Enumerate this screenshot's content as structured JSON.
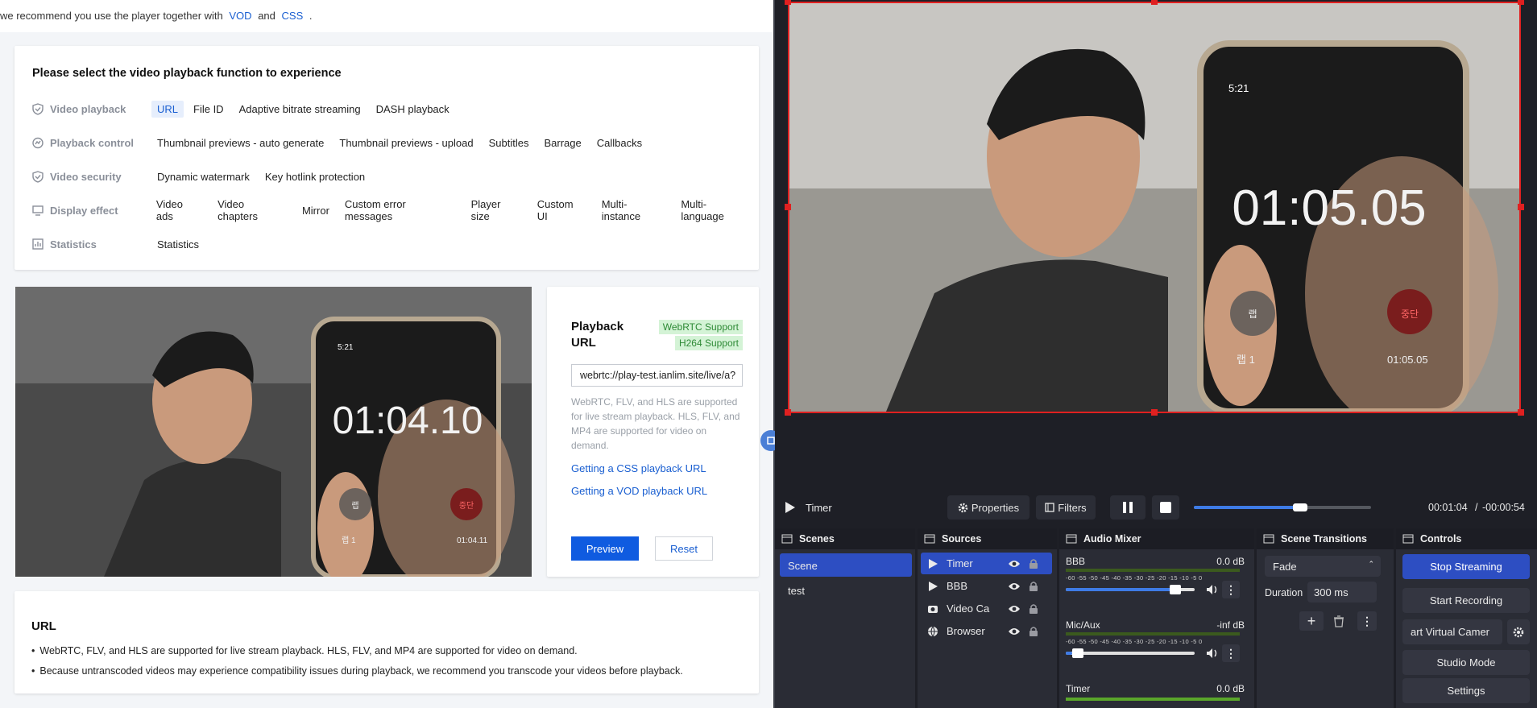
{
  "notice": {
    "pre": "we recommend you use the player together with",
    "link1": "VOD",
    "and": "and",
    "link2": "CSS",
    "post": "."
  },
  "features": {
    "title": "Please select the video playback function to experience",
    "rows": [
      {
        "category": "Video playback",
        "icon": "shield-icon",
        "items": [
          "URL",
          "File ID",
          "Adaptive bitrate streaming",
          "DASH playback"
        ]
      },
      {
        "category": "Playback control",
        "icon": "control-icon",
        "items": [
          "Thumbnail previews - auto generate",
          "Thumbnail previews - upload",
          "Subtitles",
          "Barrage",
          "Callbacks"
        ]
      },
      {
        "category": "Video security",
        "icon": "shield-check-icon",
        "items": [
          "Dynamic watermark",
          "Key hotlink protection"
        ]
      },
      {
        "category": "Display effect",
        "icon": "monitor-icon",
        "items": [
          "Video ads",
          "Video chapters",
          "Mirror",
          "Custom error messages",
          "Player size",
          "Custom UI",
          "Multi-instance",
          "Multi-language"
        ]
      },
      {
        "category": "Statistics",
        "icon": "bar-chart-icon",
        "items": [
          "Statistics"
        ]
      }
    ],
    "active": "URL"
  },
  "video": {
    "timer": "01:04.10",
    "phone_time": "5:21",
    "phone_small": "01:04.11",
    "phone_label": "랩 1",
    "stop_label": "중단",
    "lap_label": "랩"
  },
  "playback": {
    "title": "Playback URL",
    "badges": [
      "WebRTC Support",
      "H264 Support"
    ],
    "url_value": "webrtc://play-test.ianlim.site/live/a?",
    "description": "WebRTC, FLV, and HLS are supported for live stream playback. HLS, FLV, and MP4 are supported for video on demand.",
    "link_css": "Getting a CSS playback URL",
    "link_vod": "Getting a VOD playback URL",
    "preview_label": "Preview",
    "reset_label": "Reset"
  },
  "info": {
    "title": "URL",
    "bullets": [
      "WebRTC, FLV, and HLS are supported for live stream playback. HLS, FLV, and MP4 are supported for video on demand.",
      "Because untranscoded videos may experience compatibility issues during playback, we recommend you transcode your videos before playback."
    ]
  },
  "obs": {
    "preview": {
      "timer": "01:05.05",
      "phone_time": "5:21",
      "phone_small": "01:05.05",
      "phone_label": "랩 1",
      "stop_label": "중단",
      "lap_label": "랩"
    },
    "media": {
      "source": "Timer",
      "properties": "Properties",
      "filters": "Filters",
      "elapsed": "00:01:04",
      "remaining": "-00:00:54",
      "progress": 0.6
    },
    "scenes": {
      "title": "Scenes",
      "items": [
        "Scene",
        "test"
      ],
      "selected": "Scene"
    },
    "sources": {
      "title": "Sources",
      "items": [
        "Timer",
        "BBB",
        "Video Ca",
        "Browser"
      ],
      "selected": "Timer"
    },
    "mixer": {
      "title": "Audio Mixer",
      "scale": "-60 -55 -50 -45 -40 -35 -30 -25 -20 -15 -10 -5 0",
      "channels": [
        {
          "name": "BBB",
          "db": "0.0 dB",
          "volume": 0.85
        },
        {
          "name": "Mic/Aux",
          "db": "-inf dB",
          "volume": 0.05
        },
        {
          "name": "Timer",
          "db": "0.0 dB"
        }
      ]
    },
    "transitions": {
      "title": "Scene Transitions",
      "type": "Fade",
      "duration_label": "Duration",
      "duration_value": "300 ms"
    },
    "controls": {
      "title": "Controls",
      "stop_streaming": "Stop Streaming",
      "start_recording": "Start Recording",
      "virtual_camera": "art Virtual Camer",
      "studio_mode": "Studio Mode",
      "settings": "Settings"
    },
    "colors": {
      "accent": "#2d4ec2",
      "selection": "#e02020",
      "bg": "#1e1f26"
    }
  }
}
